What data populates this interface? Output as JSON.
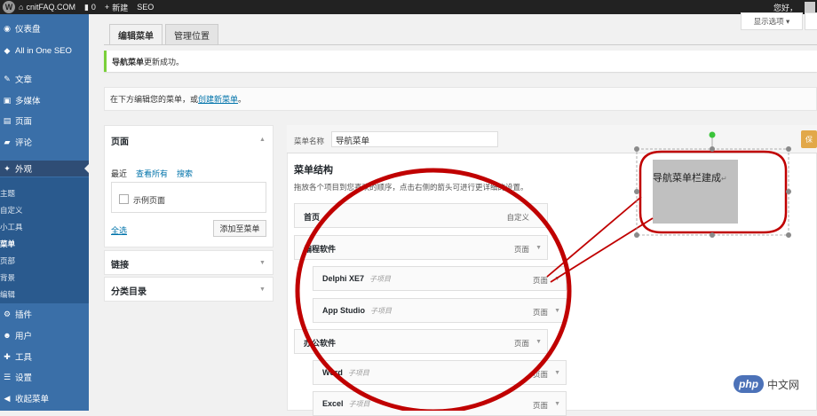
{
  "adminbar": {
    "site": "cnitFAQ.COM",
    "comments": "0",
    "new": "新建",
    "seo": "SEO",
    "greeting": "您好，"
  },
  "sidebar": {
    "items": [
      {
        "label": "仪表盘",
        "icon": "dashboard-icon"
      },
      {
        "label": "All in One SEO",
        "icon": "shield-icon"
      },
      {
        "label": "文章",
        "icon": "pin-icon"
      },
      {
        "label": "多媒体",
        "icon": "media-icon"
      },
      {
        "label": "页面",
        "icon": "page-icon"
      },
      {
        "label": "评论",
        "icon": "comment-icon"
      },
      {
        "label": "外观",
        "icon": "appearance-icon"
      },
      {
        "label": "插件",
        "icon": "plugin-icon"
      },
      {
        "label": "用户",
        "icon": "user-icon"
      },
      {
        "label": "工具",
        "icon": "tool-icon"
      },
      {
        "label": "设置",
        "icon": "settings-icon"
      },
      {
        "label": "收起菜单",
        "icon": "collapse-icon"
      }
    ],
    "submenu": [
      "主题",
      "自定义",
      "小工具",
      "菜单",
      "页部",
      "背景",
      "编辑"
    ]
  },
  "screen_options": "显示选项",
  "tabs": [
    "编辑菜单",
    "管理位置"
  ],
  "notice": {
    "bold": "导航菜单",
    "rest": " 更新成功。"
  },
  "manage": {
    "prefix": "在下方编辑您的菜单，或",
    "link": "创建新菜单",
    "suffix": "。"
  },
  "left": {
    "pages_title": "页面",
    "subtabs": [
      "最近",
      "查看所有",
      "搜索"
    ],
    "example_page": "示例页面",
    "select_all": "全选",
    "add_button": "添加至菜单",
    "links_title": "链接",
    "categories_title": "分类目录"
  },
  "right": {
    "name_label": "菜单名称",
    "name_value": "导航菜单",
    "save": "保",
    "structure_title": "菜单结构",
    "structure_desc": "拖放各个项目到您喜欢的顺序，点击右侧的箭头可进行更详细的设置。",
    "items": [
      {
        "title": "首页",
        "sub": "",
        "type": "自定义"
      },
      {
        "title": "编程软件",
        "sub": "",
        "type": "页面"
      },
      {
        "title": "Delphi XE7",
        "sub": "子项目",
        "type": "页面"
      },
      {
        "title": "App Studio",
        "sub": "子项目",
        "type": "页面"
      },
      {
        "title": "办公软件",
        "sub": "",
        "type": "页面"
      },
      {
        "title": "Word",
        "sub": "子项目",
        "type": "页面"
      },
      {
        "title": "Excel",
        "sub": "子项目",
        "type": "页面"
      }
    ]
  },
  "annotation": {
    "text": "导航菜单栏建成",
    "mark": "↵"
  },
  "watermark": {
    "logo": "php",
    "text": "中文网"
  },
  "colors": {
    "sidebar": "#3a6fa8",
    "active_menu": "#2f4d75",
    "accent": "#0073aa",
    "circle": "#c00000",
    "notice": "#7ad03a"
  }
}
